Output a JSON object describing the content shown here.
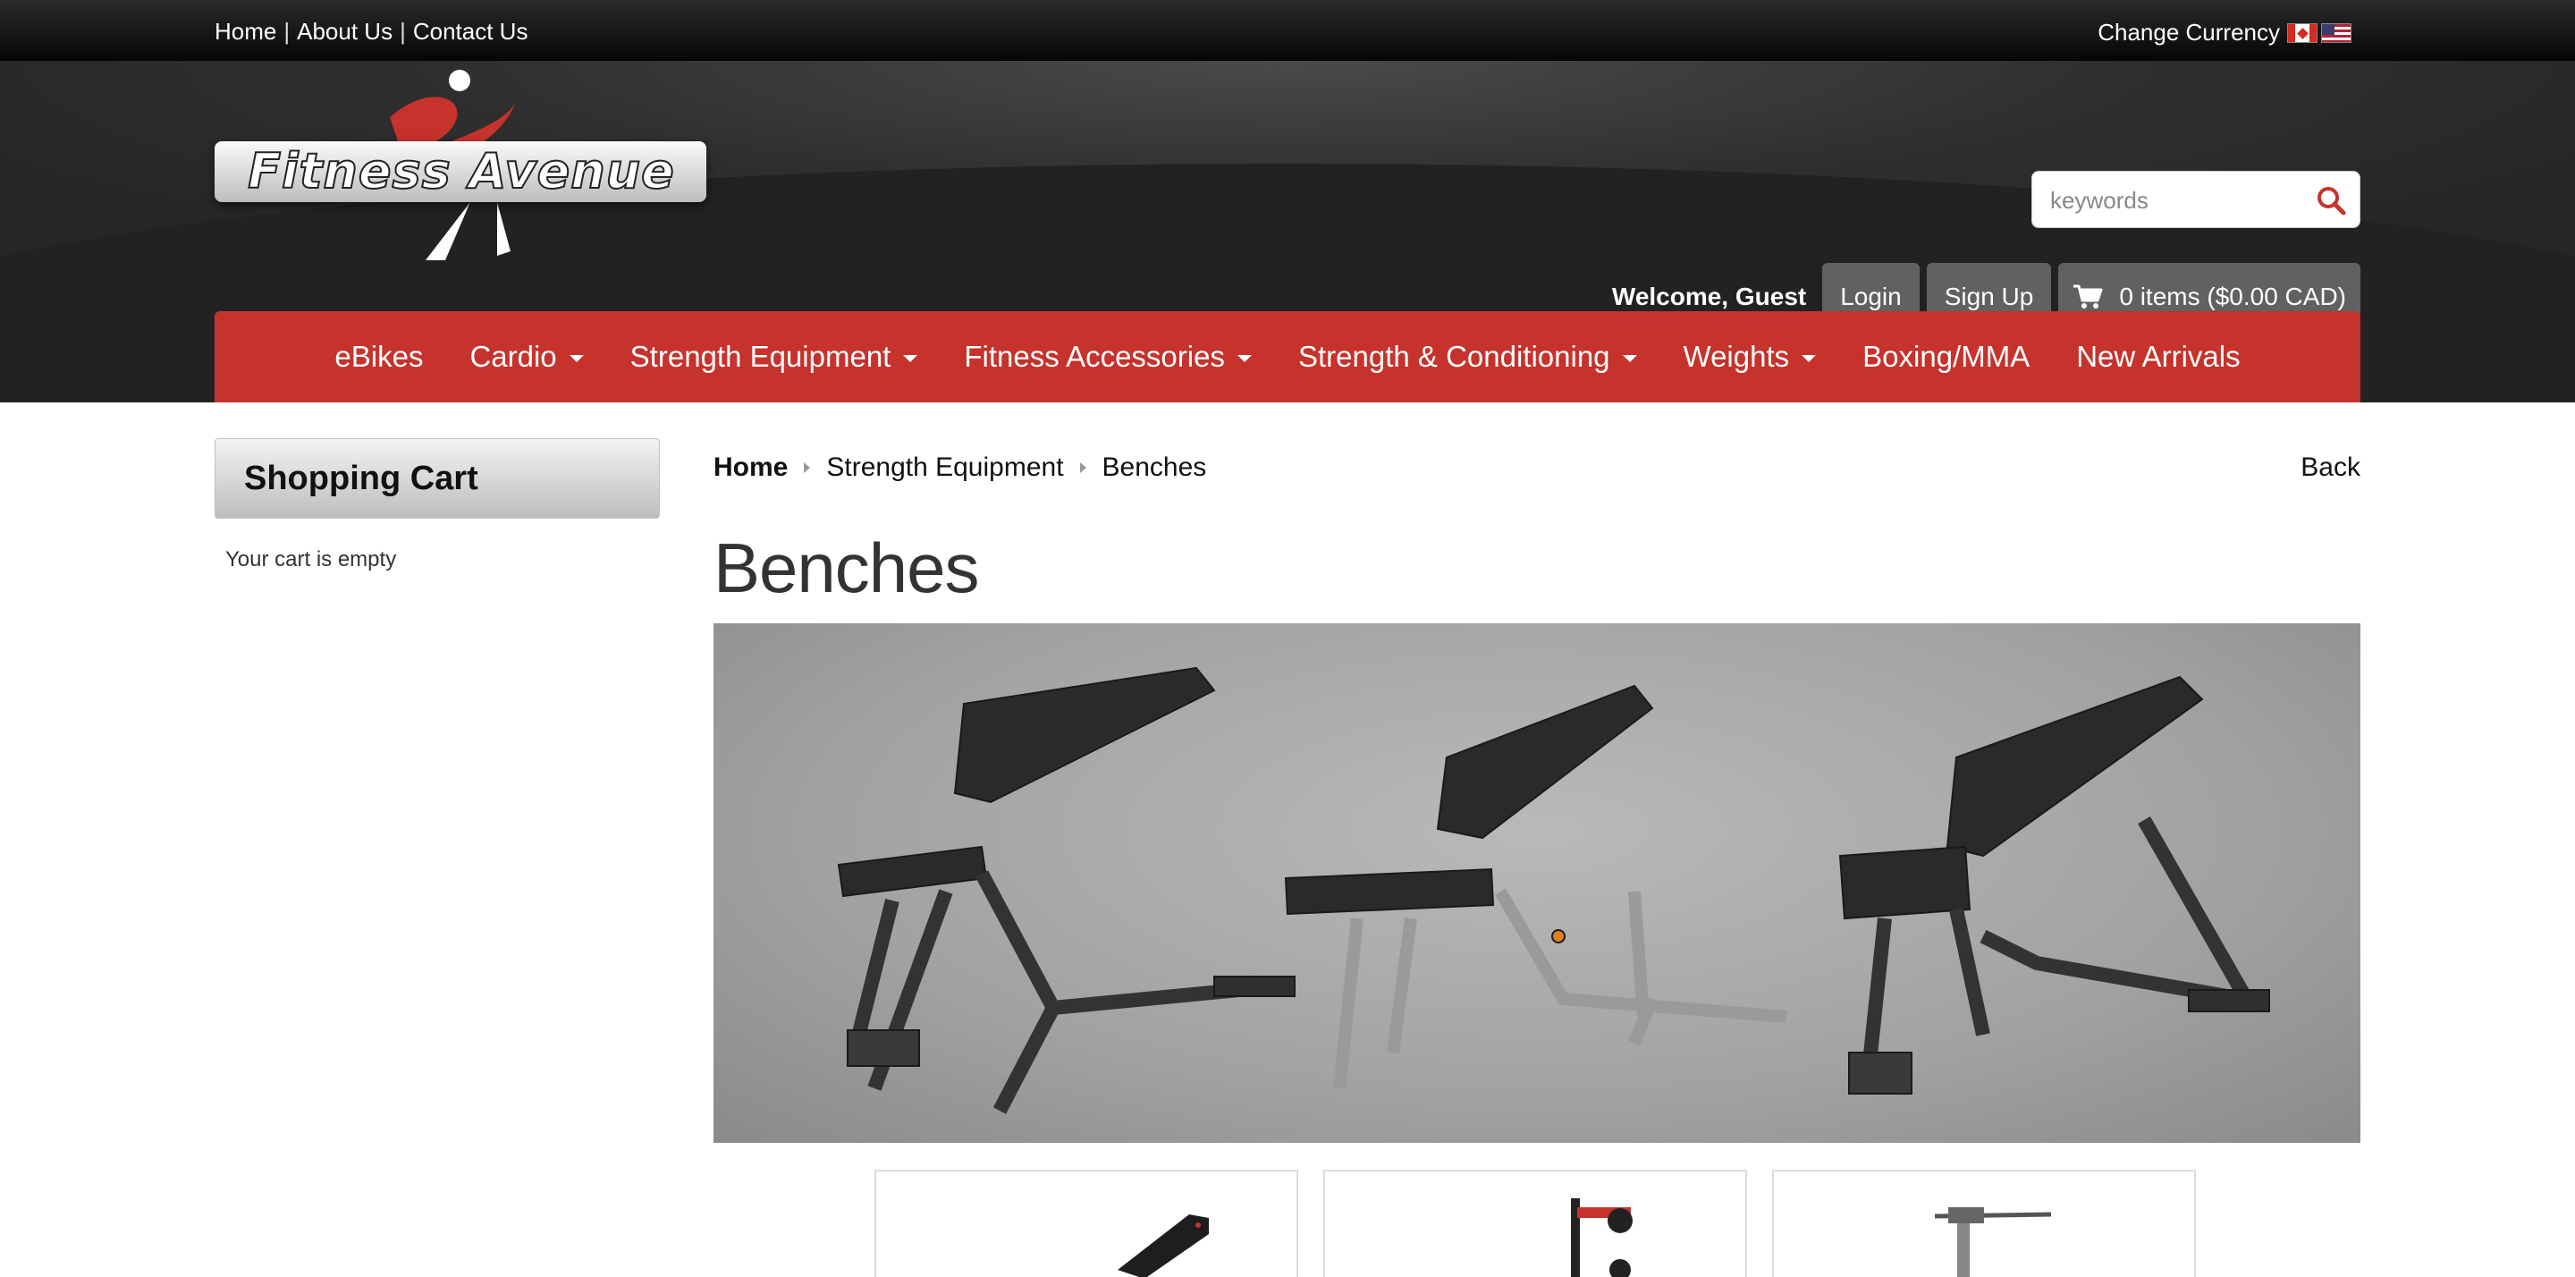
{
  "topbar": {
    "links": [
      "Home",
      "About Us",
      "Contact Us"
    ],
    "separator": "|",
    "currency_label": "Change Currency"
  },
  "header": {
    "logo_text": "Fitness Avenue",
    "search_placeholder": "keywords",
    "welcome": "Welcome, Guest",
    "login_label": "Login",
    "signup_label": "Sign Up",
    "cart_label": "0 items ($0.00 CAD)"
  },
  "nav": {
    "items": [
      {
        "label": "eBikes",
        "dropdown": false
      },
      {
        "label": "Cardio",
        "dropdown": true
      },
      {
        "label": "Strength Equipment",
        "dropdown": true
      },
      {
        "label": "Fitness Accessories",
        "dropdown": true
      },
      {
        "label": "Strength & Conditioning",
        "dropdown": true
      },
      {
        "label": "Weights",
        "dropdown": true
      },
      {
        "label": "Boxing/MMA",
        "dropdown": false
      },
      {
        "label": "New Arrivals",
        "dropdown": false
      }
    ]
  },
  "sidebar": {
    "title": "Shopping Cart",
    "empty_text": "Your cart is empty"
  },
  "main": {
    "breadcrumb": [
      "Home",
      "Strength Equipment",
      "Benches"
    ],
    "back_label": "Back",
    "title": "Benches"
  },
  "colors": {
    "nav_red": "#c6322c",
    "header_dark": "#2f2f2f",
    "button_gray": "#616161"
  }
}
